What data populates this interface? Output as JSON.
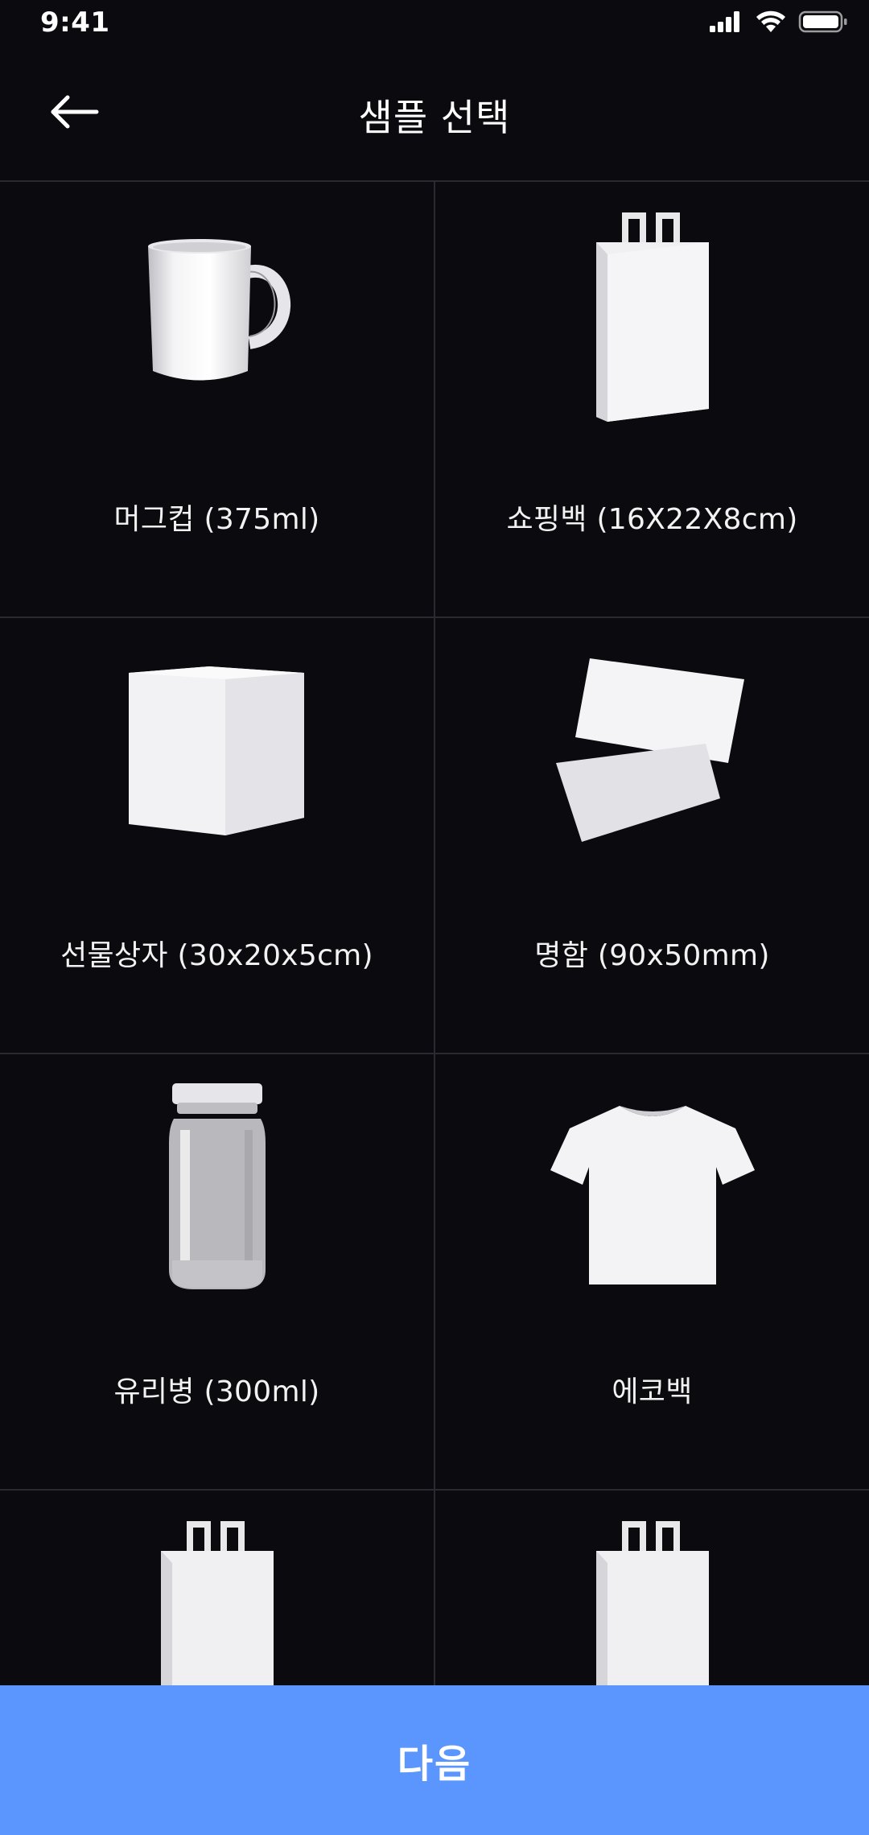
{
  "status_bar": {
    "time": "9:41"
  },
  "header": {
    "title": "샘플 선택",
    "back_icon": "arrow-left-icon"
  },
  "samples": [
    {
      "label": "머그컵 (375ml)",
      "icon": "mug-image"
    },
    {
      "label": "쇼핑백 (16X22X8cm)",
      "icon": "shopping-bag-image"
    },
    {
      "label": "선물상자 (30x20x5cm)",
      "icon": "gift-box-image"
    },
    {
      "label": "명함 (90x50mm)",
      "icon": "business-card-image"
    },
    {
      "label": "유리병 (300ml)",
      "icon": "glass-jar-image"
    },
    {
      "label": "에코백",
      "icon": "tshirt-image"
    },
    {
      "label": "",
      "icon": "shopping-bag-image"
    },
    {
      "label": "",
      "icon": "shopping-bag-image"
    }
  ],
  "footer": {
    "next_label": "다음"
  },
  "colors": {
    "background": "#0b0b0f",
    "divider": "#2a2a30",
    "accent": "#5b96fe"
  }
}
